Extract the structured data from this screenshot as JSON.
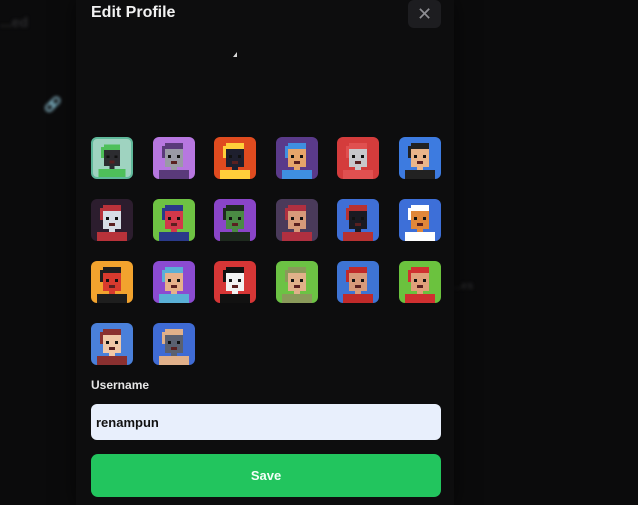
{
  "background": {
    "title": "...ed",
    "nav_text": "...es"
  },
  "modal": {
    "title": "Edit Profile",
    "close_icon": "close-icon"
  },
  "avatars": [
    {
      "name": "hooded-ninja",
      "bg": "#9fd3c0",
      "skin": "#2c2c30",
      "accent": "#4ec05a",
      "selected": true
    },
    {
      "name": "grey-alien",
      "bg": "#b777e0",
      "skin": "#9a9aa6",
      "accent": "#5a3a7a",
      "selected": false
    },
    {
      "name": "bomb",
      "bg": "#e04b1f",
      "skin": "#1e1f2e",
      "accent": "#ffcf3a",
      "selected": false
    },
    {
      "name": "cyborg-blue-mohawk",
      "bg": "#5a3a8a",
      "skin": "#e6a56a",
      "accent": "#3f8fe0",
      "selected": false
    },
    {
      "name": "robot-head",
      "bg": "#d43c3c",
      "skin": "#c8c8cc",
      "accent": "#e05050",
      "selected": false
    },
    {
      "name": "glasses-man",
      "bg": "#3d7be0",
      "skin": "#e9b58a",
      "accent": "#222222",
      "selected": false
    },
    {
      "name": "red-hair-woman",
      "bg": "#2c1d2e",
      "skin": "#d7dde6",
      "accent": "#b8323a",
      "selected": false
    },
    {
      "name": "red-monster",
      "bg": "#6ec243",
      "skin": "#d2384a",
      "accent": "#2a3a8a",
      "selected": false
    },
    {
      "name": "green-dreads",
      "bg": "#8a45c8",
      "skin": "#4a8a44",
      "accent": "#1e2a1e",
      "selected": false
    },
    {
      "name": "punk-woman",
      "bg": "#4a3a5a",
      "skin": "#d89a7a",
      "accent": "#b03040",
      "selected": false
    },
    {
      "name": "red-hood",
      "bg": "#3f6fd6",
      "skin": "#1a1a22",
      "accent": "#b73232",
      "selected": false
    },
    {
      "name": "orange-beast",
      "bg": "#3d6fd8",
      "skin": "#e0873a",
      "accent": "#ffffff",
      "selected": false
    },
    {
      "name": "red-devil",
      "bg": "#f2a32e",
      "skin": "#d83a2e",
      "accent": "#1e1e1e",
      "selected": false
    },
    {
      "name": "blue-buns-girl",
      "bg": "#8b4bd1",
      "skin": "#e6b08a",
      "accent": "#5ab0d6",
      "selected": false
    },
    {
      "name": "corpse-paint",
      "bg": "#d63636",
      "skin": "#f2f2f2",
      "accent": "#111111",
      "selected": false
    },
    {
      "name": "helmet-soldier",
      "bg": "#6cc244",
      "skin": "#e0b18a",
      "accent": "#8a9a5a",
      "selected": false
    },
    {
      "name": "eyepatch-cyborg",
      "bg": "#3e74d4",
      "skin": "#d89a7a",
      "accent": "#c02a2a",
      "selected": false
    },
    {
      "name": "red-mohawk-punk",
      "bg": "#6bc23e",
      "skin": "#e0a07a",
      "accent": "#d03030",
      "selected": false
    },
    {
      "name": "skull",
      "bg": "#4a80da",
      "skin": "#f0c8a8",
      "accent": "#8a3030",
      "selected": false
    },
    {
      "name": "visor-soldier",
      "bg": "#3f6bd4",
      "skin": "#5a6070",
      "accent": "#e0b08a",
      "selected": false
    }
  ],
  "form": {
    "username_label": "Username",
    "username_value": "renampun",
    "save_label": "Save"
  },
  "colors": {
    "accent": "#22c55e",
    "input_bg": "#e8effc",
    "modal_bg": "#0d0d0e"
  }
}
